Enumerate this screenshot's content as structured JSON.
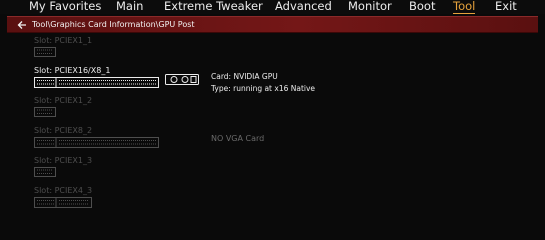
{
  "menu": {
    "items": [
      {
        "label": "My Favorites"
      },
      {
        "label": "Main"
      },
      {
        "label": "Extreme Tweaker"
      },
      {
        "label": "Advanced"
      },
      {
        "label": "Monitor"
      },
      {
        "label": "Boot"
      },
      {
        "label": "Tool",
        "active": true
      },
      {
        "label": "Exit"
      }
    ]
  },
  "breadcrumb": {
    "icon": "back-arrow-icon",
    "text": "Tool\\Graphics Card Information\\GPU Post"
  },
  "slots": [
    {
      "label": "Slot: PCIEX1_1",
      "populated": false
    },
    {
      "label": "Slot: PCIEX16/X8_1",
      "populated": true
    },
    {
      "label": "Slot: PCIEX1_2",
      "populated": false
    },
    {
      "label": "Slot: PCIEX8_2",
      "populated": false
    },
    {
      "label": "Slot: PCIEX1_3",
      "populated": false
    },
    {
      "label": "Slot: PCIEX4_3",
      "populated": false
    }
  ],
  "card_info": {
    "card": "Card: NVIDIA GPU",
    "type": "Type: running at x16 Native"
  },
  "no_vga": "NO VGA Card",
  "colors": {
    "accent": "#e6a23c",
    "breadcrumb_bar": "#741717",
    "active_text": "#ececec",
    "inactive_text": "#4e4e4e"
  }
}
